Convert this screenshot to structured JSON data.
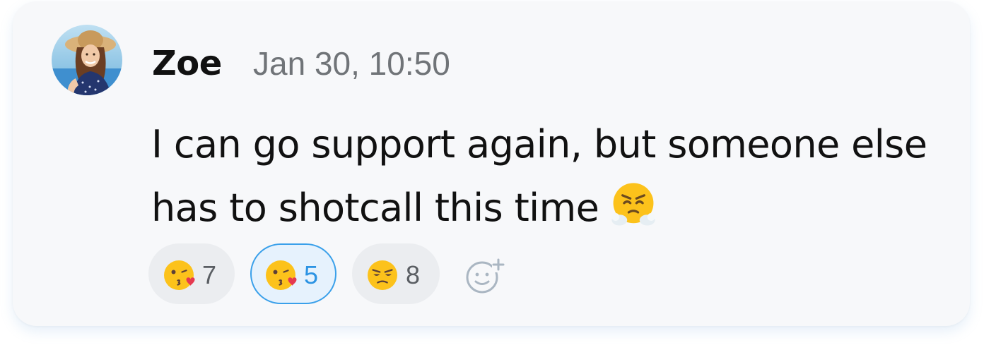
{
  "message": {
    "author": "Zoe",
    "timestamp": "Jan 30, 10:50",
    "text": "I can go support again, but someone else has to shotcall this time",
    "inline_emoji": "face-with-steam-from-nose-icon"
  },
  "reactions": [
    {
      "emoji": "face-blowing-a-kiss-icon",
      "count": "7",
      "selected": false
    },
    {
      "emoji": "face-blowing-a-kiss-icon",
      "count": "5",
      "selected": true
    },
    {
      "emoji": "unamused-face-icon",
      "count": "8",
      "selected": false
    }
  ],
  "add_reaction_icon": "add-reaction-icon",
  "colors": {
    "card_bg": "#f7f8fa",
    "pill_bg": "#ebedf0",
    "selected_border": "#3aa0ea",
    "selected_count": "#2b93e3",
    "timestamp": "#707478"
  }
}
